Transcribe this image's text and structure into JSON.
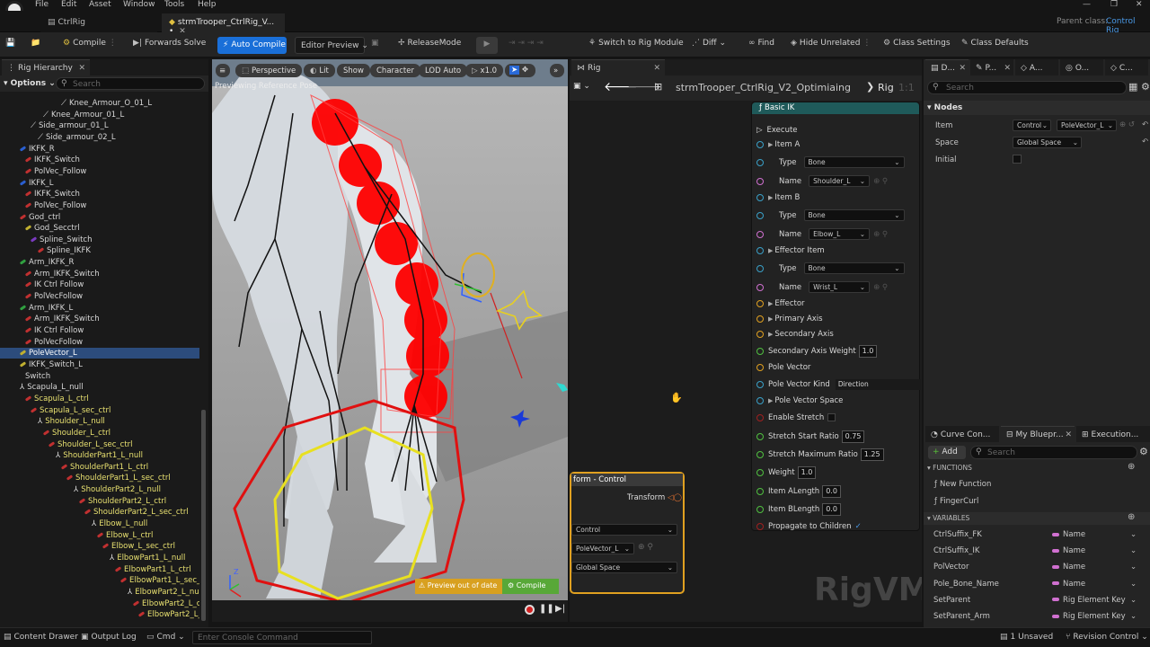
{
  "menu": {
    "file": "File",
    "edit": "Edit",
    "asset": "Asset",
    "window": "Window",
    "tools": "Tools",
    "help": "Help"
  },
  "tabs": {
    "tab1": "CtrlRig",
    "tab2": "strmTrooper_CtrlRig_V... •",
    "parent_label": "Parent class:",
    "parent_value": "Control Rig"
  },
  "toolbar": {
    "compile": "Compile",
    "forwards_solve": "Forwards Solve",
    "auto_compile": "Auto Compile",
    "editor_preview": "Editor Preview",
    "release_mode": "ReleaseMode",
    "switch_module": "Switch to Rig Module",
    "diff": "Diff",
    "find": "Find",
    "hide_unrelated": "Hide Unrelated",
    "class_settings": "Class Settings",
    "class_defaults": "Class Defaults"
  },
  "hierarchy": {
    "tab": "Rig Hierarchy",
    "options": "Options",
    "search_placeholder": "Search",
    "items": [
      {
        "label": "Knee_Armour_O_01_L",
        "indent": 68,
        "color": "#d8d8d8",
        "sel": false,
        "icon": "bone"
      },
      {
        "label": "Knee_Armour_01_L",
        "indent": 48,
        "color": "#d8d8d8",
        "sel": false,
        "icon": "bone"
      },
      {
        "label": "Side_armour_01_L",
        "indent": 34,
        "color": "#d8d8d8",
        "sel": false,
        "icon": "bone"
      },
      {
        "label": "Side_armour_02_L",
        "indent": 42,
        "color": "#d8d8d8",
        "sel": false,
        "icon": "bone"
      },
      {
        "label": "IKFK_R",
        "indent": 22,
        "color": "#d8d8d8",
        "sel": false,
        "icon": "#2a5fd0"
      },
      {
        "label": "IKFK_Switch",
        "indent": 28,
        "color": "#d8d8d8",
        "sel": false,
        "icon": "#c03030"
      },
      {
        "label": "PolVec_Follow",
        "indent": 28,
        "color": "#d8d8d8",
        "sel": false,
        "icon": "#c03030"
      },
      {
        "label": "IKFK_L",
        "indent": 22,
        "color": "#d8d8d8",
        "sel": false,
        "icon": "#2a5fd0"
      },
      {
        "label": "IKFK_Switch",
        "indent": 28,
        "color": "#d8d8d8",
        "sel": false,
        "icon": "#c03030"
      },
      {
        "label": "PolVec_Follow",
        "indent": 28,
        "color": "#d8d8d8",
        "sel": false,
        "icon": "#c03030"
      },
      {
        "label": "God_ctrl",
        "indent": 22,
        "color": "#d8d8d8",
        "sel": false,
        "icon": "#c03030"
      },
      {
        "label": "God_Secctrl",
        "indent": 28,
        "color": "#d8d8d8",
        "sel": false,
        "icon": "#c0b030"
      },
      {
        "label": "Spline_Switch",
        "indent": 34,
        "color": "#d8d8d8",
        "sel": false,
        "icon": "#7a3ac0"
      },
      {
        "label": "Spline_IKFK",
        "indent": 42,
        "color": "#d8d8d8",
        "sel": false,
        "icon": "#c03030"
      },
      {
        "label": "Arm_IKFK_R",
        "indent": 22,
        "color": "#d8d8d8",
        "sel": false,
        "icon": "#30a040"
      },
      {
        "label": "Arm_IKFK_Switch",
        "indent": 28,
        "color": "#d8d8d8",
        "sel": false,
        "icon": "#c03030"
      },
      {
        "label": "IK Ctrl Follow",
        "indent": 28,
        "color": "#d8d8d8",
        "sel": false,
        "icon": "#c03030"
      },
      {
        "label": "PolVecFollow",
        "indent": 28,
        "color": "#d8d8d8",
        "sel": false,
        "icon": "#c03030"
      },
      {
        "label": "Arm_IKFK_L",
        "indent": 22,
        "color": "#d8d8d8",
        "sel": false,
        "icon": "#30a040"
      },
      {
        "label": "Arm_IKFK_Switch",
        "indent": 28,
        "color": "#d8d8d8",
        "sel": false,
        "icon": "#c03030"
      },
      {
        "label": "IK Ctrl Follow",
        "indent": 28,
        "color": "#d8d8d8",
        "sel": false,
        "icon": "#c03030"
      },
      {
        "label": "PolVecFollow",
        "indent": 28,
        "color": "#d8d8d8",
        "sel": false,
        "icon": "#c03030"
      },
      {
        "label": "PoleVector_L",
        "indent": 22,
        "color": "#ffffff",
        "sel": true,
        "icon": "#c0b030"
      },
      {
        "label": "IKFK_Switch_L",
        "indent": 22,
        "color": "#d8d8d8",
        "sel": false,
        "icon": "#c0b030"
      },
      {
        "label": "Switch",
        "indent": 28,
        "color": "#d8d8d8",
        "sel": false,
        "icon": "none"
      },
      {
        "label": "Scapula_L_null",
        "indent": 22,
        "color": "#d8d8d8",
        "sel": false,
        "icon": "null"
      },
      {
        "label": "Scapula_L_ctrl",
        "indent": 28,
        "color": "#e8e070",
        "sel": false,
        "icon": "#c03030"
      },
      {
        "label": "Scapula_L_sec_ctrl",
        "indent": 34,
        "color": "#e8e070",
        "sel": false,
        "icon": "#c03030"
      },
      {
        "label": "Shoulder_L_null",
        "indent": 42,
        "color": "#e8e070",
        "sel": false,
        "icon": "null"
      },
      {
        "label": "Shoulder_L_ctrl",
        "indent": 48,
        "color": "#e8e070",
        "sel": false,
        "icon": "#c03030"
      },
      {
        "label": "Shoulder_L_sec_ctrl",
        "indent": 54,
        "color": "#e8e070",
        "sel": false,
        "icon": "#c03030"
      },
      {
        "label": "ShoulderPart1_L_null",
        "indent": 62,
        "color": "#e8e070",
        "sel": false,
        "icon": "null"
      },
      {
        "label": "ShoulderPart1_L_ctrl",
        "indent": 68,
        "color": "#e8e070",
        "sel": false,
        "icon": "#c03030"
      },
      {
        "label": "ShoulderPart1_L_sec_ctrl",
        "indent": 74,
        "color": "#e8e070",
        "sel": false,
        "icon": "#c03030"
      },
      {
        "label": "ShoulderPart2_L_null",
        "indent": 82,
        "color": "#e8e070",
        "sel": false,
        "icon": "null"
      },
      {
        "label": "ShoulderPart2_L_ctrl",
        "indent": 88,
        "color": "#e8e070",
        "sel": false,
        "icon": "#c03030"
      },
      {
        "label": "ShoulderPart2_L_sec_ctrl",
        "indent": 94,
        "color": "#e8e070",
        "sel": false,
        "icon": "#c03030"
      },
      {
        "label": "Elbow_L_null",
        "indent": 102,
        "color": "#e8e070",
        "sel": false,
        "icon": "null"
      },
      {
        "label": "Elbow_L_ctrl",
        "indent": 108,
        "color": "#e8e070",
        "sel": false,
        "icon": "#c03030"
      },
      {
        "label": "Elbow_L_sec_ctrl",
        "indent": 114,
        "color": "#e8e070",
        "sel": false,
        "icon": "#c03030"
      },
      {
        "label": "ElbowPart1_L_null",
        "indent": 122,
        "color": "#e8e070",
        "sel": false,
        "icon": "null"
      },
      {
        "label": "ElbowPart1_L_ctrl",
        "indent": 128,
        "color": "#e8e070",
        "sel": false,
        "icon": "#c03030"
      },
      {
        "label": "ElbowPart1_L_sec_ctr",
        "indent": 134,
        "color": "#e8e070",
        "sel": false,
        "icon": "#c03030"
      },
      {
        "label": "ElbowPart2_L_null",
        "indent": 142,
        "color": "#e8e070",
        "sel": false,
        "icon": "null"
      },
      {
        "label": "ElbowPart2_L_ctrl",
        "indent": 148,
        "color": "#e8e070",
        "sel": false,
        "icon": "#c03030"
      },
      {
        "label": "ElbowPart2_L_se",
        "indent": 154,
        "color": "#e8e070",
        "sel": false,
        "icon": "#c03030"
      }
    ]
  },
  "viewport": {
    "menu_icon": "≡",
    "perspective": "Perspective",
    "lit": "Lit",
    "show": "Show",
    "character": "Character",
    "lod": "LOD Auto",
    "speed": "x1.0",
    "notice": "Previewing Reference Pose",
    "preview_out_of_date": "Preview out of date",
    "compile": "Compile"
  },
  "graph": {
    "tab": "Rig",
    "breadcrumb": "strmTrooper_CtrlRig_V2_Optimiaing",
    "breadcrumb2": "Rig",
    "zoom": "1:1",
    "watermark": "RigVM",
    "node_title": "Basic IK",
    "rows": {
      "execute": "Execute",
      "item_a": "Item A",
      "type": "Type",
      "bone": "Bone",
      "name": "Name",
      "shoulder": "Shoulder_L",
      "item_b": "Item B",
      "elbow": "Elbow_L",
      "effector_item": "Effector Item",
      "wrist": "Wrist_L",
      "effector": "Effector",
      "primary_axis": "Primary Axis",
      "secondary_axis": "Secondary Axis",
      "secondary_axis_weight": "Secondary Axis Weight",
      "saw_val": "1.0",
      "pole_vector": "Pole Vector",
      "pole_vector_kind": "Pole Vector Kind",
      "direction": "Direction",
      "pole_vector_space": "Pole Vector Space",
      "enable_stretch": "Enable Stretch",
      "stretch_start": "Stretch Start Ratio",
      "ssr_val": "0.75",
      "stretch_max": "Stretch Maximum Ratio",
      "smr_val": "1.25",
      "weight": "Weight",
      "weight_val": "1.0",
      "item_a_length": "Item ALength",
      "ial_val": "0.0",
      "item_b_length": "Item BLength",
      "ibl_val": "0.0",
      "propagate": "Propagate to Children",
      "check": "✓"
    },
    "node2_title": "form - Control",
    "node2_transform": "Transform",
    "node2_type": "Control",
    "node2_name": "PoleVector_L",
    "node2_space": "Global Space"
  },
  "details": {
    "tabs": [
      "D...",
      "P...",
      "A...",
      "O...",
      "C..."
    ],
    "search_placeholder": "Search",
    "section": "Nodes",
    "item_label": "Item",
    "item_type": "Control",
    "item_value": "PoleVector_L",
    "space_label": "Space",
    "space_value": "Global Space",
    "initial_label": "Initial"
  },
  "myblueprint": {
    "tabs": [
      "Curve Con...",
      "My Bluepr...",
      "Execution..."
    ],
    "add": "Add",
    "search_placeholder": "Search",
    "functions_header": "FUNCTIONS",
    "functions": [
      "New Function",
      "FingerCurl"
    ],
    "variables_header": "VARIABLES",
    "variables": [
      {
        "name": "CtrlSuffix_FK",
        "type": "Name",
        "color": "#d070d0"
      },
      {
        "name": "CtrlSuffix_IK",
        "type": "Name",
        "color": "#d070d0"
      },
      {
        "name": "PolVector",
        "type": "Name",
        "color": "#d070d0"
      },
      {
        "name": "Pole_Bone_Name",
        "type": "Name",
        "color": "#d070d0"
      },
      {
        "name": "SetParent",
        "type": "Rig Element Key",
        "color": "#d070d0"
      },
      {
        "name": "SetParent_Arm",
        "type": "Rig Element Key",
        "color": "#d070d0"
      }
    ]
  },
  "status": {
    "content_drawer": "Content Drawer",
    "output_log": "Output Log",
    "cmd": "Cmd",
    "console_placeholder": "Enter Console Command",
    "unsaved": "1 Unsaved",
    "revision": "Revision Control"
  }
}
